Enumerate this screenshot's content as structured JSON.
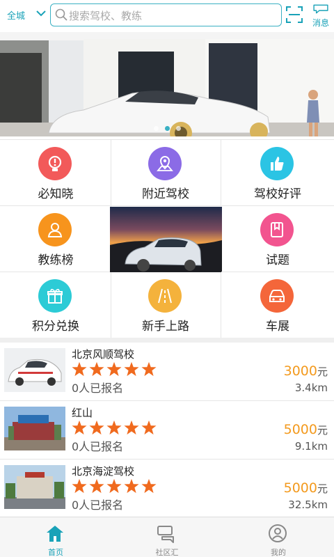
{
  "header": {
    "city": "全城",
    "search_placeholder": "搜索驾校、教练",
    "message_label": "消息"
  },
  "banner": {
    "slide_count": 3,
    "active_slide": 2
  },
  "grid": [
    {
      "label": "必知晓",
      "icon": "lightbulb-icon",
      "color": "#f25a5a"
    },
    {
      "label": "附近驾校",
      "icon": "map-pin-icon",
      "color": "#8b6be6"
    },
    {
      "label": "驾校好评",
      "icon": "thumbs-up-icon",
      "color": "#2bc4e4"
    },
    {
      "label": "教练榜",
      "icon": "person-icon",
      "color": "#f7941d"
    },
    {
      "label": "试题",
      "icon": "book-icon",
      "color": "#f2548f"
    },
    {
      "label": "积分兑换",
      "icon": "gift-icon",
      "color": "#2ccbd6"
    },
    {
      "label": "新手上路",
      "icon": "road-icon",
      "color": "#f4b23c"
    },
    {
      "label": "车展",
      "icon": "car-icon",
      "color": "#f4663a"
    }
  ],
  "schools": [
    {
      "name": "北京风顺驾校",
      "stars": 5,
      "enrolled": "0人已报名",
      "price": "3000",
      "unit": "元",
      "distance": "3.4km"
    },
    {
      "name": "红山",
      "stars": 5,
      "enrolled": "0人已报名",
      "price": "5000",
      "unit": "元",
      "distance": "9.1km"
    },
    {
      "name": "北京海淀驾校",
      "stars": 5,
      "enrolled": "0人已报名",
      "price": "5000",
      "unit": "元",
      "distance": "32.5km"
    }
  ],
  "tabbar": [
    {
      "label": "首页",
      "icon": "home-icon",
      "active": true
    },
    {
      "label": "社区汇",
      "icon": "community-icon",
      "active": false
    },
    {
      "label": "我的",
      "icon": "profile-icon",
      "active": false
    }
  ],
  "colors": {
    "accent": "#19a2b8",
    "price": "#f39a1e",
    "star": "#f06a1e"
  }
}
